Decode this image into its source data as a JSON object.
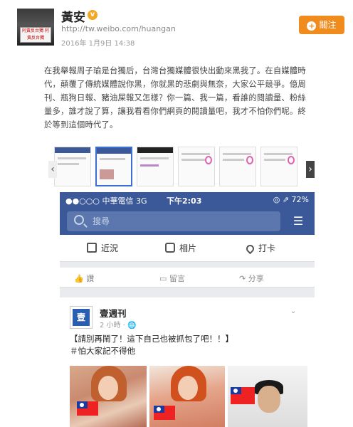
{
  "header": {
    "user_name": "黃安",
    "verified_icon": "v",
    "profile_url": "http://tw.weibo.com/huangan",
    "post_time": "2016年 1月9日 14:38",
    "follow_label": "關注",
    "avatar_sign_text": "阿黃反台獨 阿黃反台獨"
  },
  "post": {
    "text": "在我舉報周子瑜是台獨后，台灣台獨媒體很快出動來黑我了。在自媒體時代，顛覆了傳統媒體說你黑，你就黑的悲劇與無奈，大家公平競爭。億周刊、瓶狗日報、豬油屎報又怎樣？你一篇、我一篇，看誰的閱讀量、粉絲量多，誰才說了算，讓我看看你們網頁的閱讀量吧，我才不怕你們呢。終於等到這個時代了。"
  },
  "strip": {
    "left_arrow": "‹",
    "right_arrow": "›"
  },
  "phone": {
    "status": {
      "carrier": "●●○○○ 中華電信  3G",
      "time": "下午2:03",
      "right": "◎ ⇗ 72%"
    },
    "search_placeholder": "搜尋",
    "composer": {
      "status_label": "近況",
      "photo_label": "相片",
      "checkin_label": "打卡"
    },
    "reactions": {
      "like_label": "讚",
      "comment_label": "留言",
      "share_label": "分享"
    },
    "page_post": {
      "page_name": "壹週刊",
      "avatar_text": "壹",
      "time": "2 小時 · ",
      "menu": "⌄",
      "line1": "【請別再鬧了！這下自己也被抓包了吧！！】",
      "line2": "＃怕大家記不得他"
    }
  },
  "colors": {
    "facebook_blue": "#3b5998",
    "follow_orange": "#f08b1d",
    "verify_gold": "#f5a623"
  }
}
